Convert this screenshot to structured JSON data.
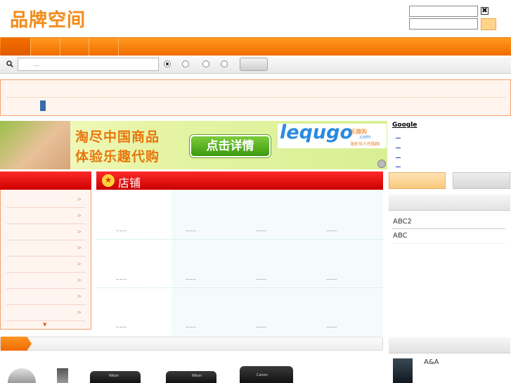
{
  "header": {
    "logo_text": "品牌空间",
    "close_glyph": "✖"
  },
  "search": {
    "placeholder": "..."
  },
  "banner": {
    "line1": "淘尽中国商品",
    "line2": "体验乐趣代购",
    "button": "点击详情",
    "brand": "lequgo",
    "brand_cn": "乐趣购",
    "brand_domain": ".com",
    "brand_sub": "海外华人代购网"
  },
  "google_box": {
    "title": "Google"
  },
  "shops": {
    "title": "店铺",
    "star_glyph": "★",
    "placeholder": "......"
  },
  "categories": {
    "arrow": ">",
    "more": "▼"
  },
  "right_panel": {
    "links": [
      "ABC2",
      "ABC"
    ],
    "thumb_label": "A&A"
  },
  "products": [
    {
      "brand": "Nikon"
    },
    {
      "brand": "Nikon"
    },
    {
      "brand": "Canon"
    }
  ],
  "colors": {
    "accent_orange": "#f26b00",
    "accent_red": "#cc0000",
    "notice_border": "#f0a070"
  }
}
